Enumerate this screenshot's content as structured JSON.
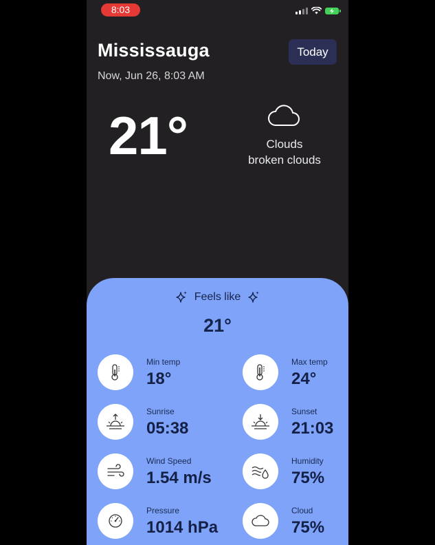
{
  "status_bar": {
    "time": "8:03"
  },
  "header": {
    "city": "Mississauga",
    "today_button": "Today",
    "datetime": "Now, Jun 26, 8:03 AM"
  },
  "current": {
    "temperature": "21°",
    "condition": "Clouds",
    "description": "broken clouds",
    "icon": "cloud-icon"
  },
  "details": {
    "feels_like_label": "Feels like",
    "feels_like_value": "21°",
    "stats": [
      {
        "label": "Min temp",
        "value": "18°",
        "icon": "thermometer-icon"
      },
      {
        "label": "Max temp",
        "value": "24°",
        "icon": "thermometer-icon"
      },
      {
        "label": "Sunrise",
        "value": "05:38",
        "icon": "sunrise-icon"
      },
      {
        "label": "Sunset",
        "value": "21:03",
        "icon": "sunset-icon"
      },
      {
        "label": "Wind Speed",
        "value": "1.54 m/s",
        "icon": "wind-icon"
      },
      {
        "label": "Humidity",
        "value": "75%",
        "icon": "humidity-icon"
      },
      {
        "label": "Pressure",
        "value": "1014 hPa",
        "icon": "gauge-icon"
      },
      {
        "label": "Cloud",
        "value": "75%",
        "icon": "cloud-icon"
      }
    ]
  },
  "colors": {
    "background": "#222023",
    "card": "#7ea3f8",
    "today_button": "#2c2f55",
    "status_time": "#e53935",
    "battery": "#43d159"
  }
}
